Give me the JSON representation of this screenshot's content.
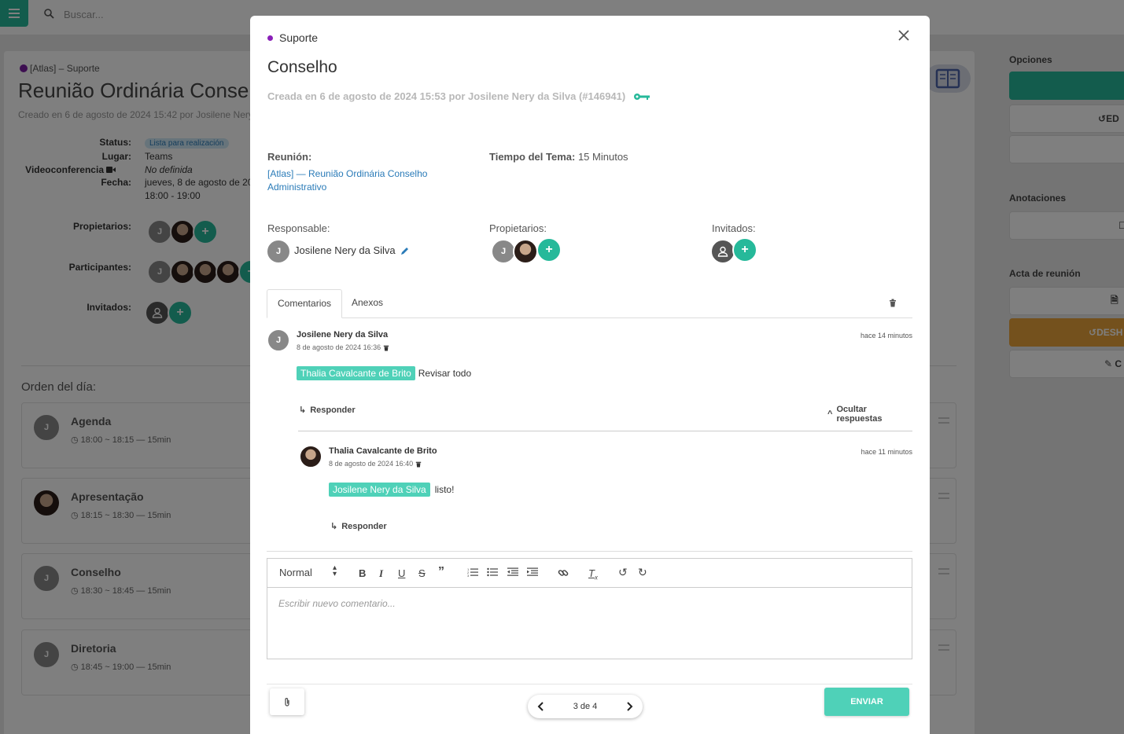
{
  "app": {
    "search_placeholder": "Buscar..."
  },
  "background": {
    "breadcrumb": "[Atlas] – Suporte",
    "title": "Reunião Ordinária Consel",
    "subtitle": "Creado en 6 de agosto de 2024 15:42 por Josilene Nery d",
    "fields": {
      "status_label": "Status:",
      "status_value": "Lista para realización",
      "lugar_label": "Lugar:",
      "lugar_value": "Teams",
      "video_label": "Videoconferencia",
      "video_value": "No definida",
      "fecha_label": "Fecha:",
      "fecha_value": "jueves, 8 de agosto de 20",
      "fecha_time": "18:00 - 19:00",
      "propietarios_label": "Propietarios:",
      "participantes_label": "Participantes:",
      "invitados_label": "Invitados:"
    },
    "orden_title": "Orden del día:",
    "agenda": [
      {
        "title": "Agenda",
        "time": "18:00 ~ 18:15 — 15min",
        "avatar": "J"
      },
      {
        "title": "Apresentação",
        "time": "18:15 ~ 18:30 — 15min",
        "avatar": ""
      },
      {
        "title": "Conselho",
        "time": "18:30 ~ 18:45 — 15min",
        "avatar": "J"
      },
      {
        "title": "Diretoria",
        "time": "18:45 ~ 19:00 — 15min",
        "avatar": "J"
      }
    ],
    "right_panel": {
      "opciones": "Opciones",
      "ed_button": "ED",
      "anotaciones": "Anotaciones",
      "acta": "Acta de reunión",
      "desh_button": "DESH"
    }
  },
  "modal": {
    "category": "Suporte",
    "title": "Conselho",
    "meta": "Creada en 6 de agosto de 2024 15:53 por Josilene Nery da Silva (#146941)",
    "reunion_label": "Reunión:",
    "reunion_link_1": "[Atlas] — Reunião Ordinária Conselho",
    "reunion_link_2": "Administrativo",
    "tiempo_label": "Tiempo del Tema:",
    "tiempo_value": "15 Minutos",
    "responsable_label": "Responsable:",
    "responsable_name": "Josilene Nery da Silva",
    "propietarios_label": "Propietarios:",
    "invitados_label": "Invitados:",
    "tabs": [
      "Comentarios",
      "Anexos"
    ],
    "comments": [
      {
        "author": "Josilene Nery da Silva",
        "date": "8 de agosto de 2024 16:36",
        "ago": "hace 14 minutos",
        "mention": "Thalia Cavalcante de Brito",
        "text": "Revisar todo",
        "reply": "Responder",
        "hide": "Ocultar respuestas"
      },
      {
        "author": "Thalia Cavalcante de Brito",
        "date": "8 de agosto de 2024 16:40",
        "ago": "hace 11 minutos",
        "mention": "Josilene Nery da Silva",
        "text": "listo!",
        "reply": "Responder"
      }
    ],
    "editor": {
      "format": "Normal",
      "placeholder": "Escribir nuevo comentario..."
    },
    "pager": "3 de 4",
    "send": "ENVIAR"
  },
  "colors": {
    "accent": "#26b99a",
    "mention": "#4fd1b8",
    "link": "#2a7bb8",
    "category_dot": "#8a1fb8",
    "warning_button": "#e8a33a"
  }
}
